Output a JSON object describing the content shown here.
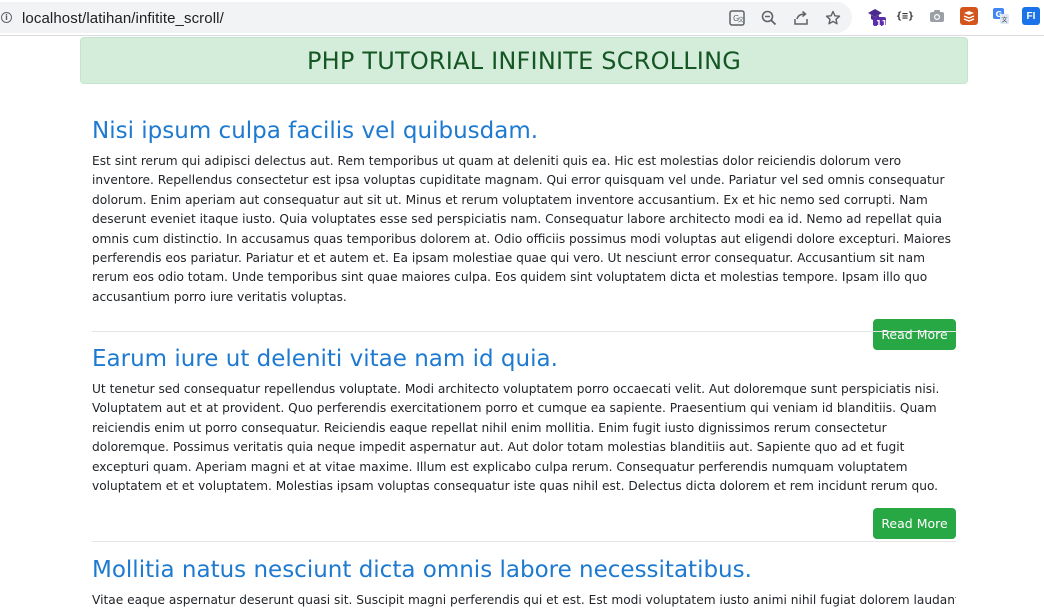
{
  "browser": {
    "url": "localhost/latihan/infitite_scroll/",
    "icons": [
      "info-icon",
      "translate-icon",
      "zoom-out-icon",
      "share-icon",
      "bookmark-star-icon",
      "extension-badge-icon",
      "json-viewer-icon",
      "camera-icon",
      "stack-icon",
      "google-translate-icon",
      "extension-fi-icon"
    ],
    "badge_count": "11",
    "json_ext_label": "{≡}",
    "fi_ext_label": "FI"
  },
  "banner": {
    "title": "PHP TUTORIAL INFINITE SCROLLING"
  },
  "posts": [
    {
      "title": "Nisi ipsum culpa facilis vel quibusdam.",
      "body": "Est sint rerum qui adipisci delectus aut. Rem temporibus ut quam at deleniti quis ea. Hic est molestias dolor reiciendis dolorum vero inventore. Repellendus consectetur est ipsa voluptas cupiditate magnam. Qui error quisquam vel unde. Pariatur vel sed omnis consequatur dolorum. Enim aperiam aut consequatur aut sit ut. Minus et rerum voluptatem inventore accusantium. Ex et hic nemo sed corrupti. Nam deserunt eveniet itaque iusto. Quia voluptates esse sed perspiciatis nam. Consequatur labore architecto modi ea id. Nemo ad repellat quia omnis cum distinctio. In accusamus quas temporibus dolorem at. Odio officiis possimus modi voluptas aut eligendi dolore excepturi. Maiores perferendis eos pariatur. Pariatur et et autem et. Ea ipsam molestiae quae qui vero. Ut nesciunt error consequatur. Accusantium sit nam rerum eos odio totam. Unde temporibus sint quae maiores culpa. Eos quidem sint voluptatem dicta et molestias tempore. Ipsam illo quo accusantium porro iure veritatis voluptas.",
      "button": "Read More"
    },
    {
      "title": "Earum iure ut deleniti vitae nam id quia.",
      "body": "Ut tenetur sed consequatur repellendus voluptate. Modi architecto voluptatem porro occaecati velit. Aut doloremque sunt perspiciatis nisi. Voluptatem aut et at provident. Quo perferendis exercitationem porro et cumque ea sapiente. Praesentium qui veniam id blanditiis. Quam reiciendis enim ut porro consequatur. Reiciendis eaque repellat nihil enim mollitia. Enim fugit iusto dignissimos rerum consectetur doloremque. Possimus veritatis quia neque impedit aspernatur aut. Aut dolor totam molestias blanditiis aut. Sapiente quo ad et fugit excepturi quam. Aperiam magni et at vitae maxime. Illum est explicabo culpa rerum. Consequatur perferendis numquam voluptatem voluptatem et et voluptatem. Molestias ipsam voluptas consequatur iste quas nihil est. Delectus dicta dolorem et rem incidunt rerum quo.",
      "button": "Read More"
    },
    {
      "title": "Mollitia natus nesciunt dicta omnis labore necessitatibus.",
      "body": "Vitae eaque aspernatur deserunt quasi sit. Suscipit magni perferendis qui et est. Est modi voluptatem iusto animi nihil fugiat dolorem laudantium. Rerum"
    }
  ],
  "colors": {
    "banner_bg": "#d4edda",
    "banner_text": "#155724",
    "title_link": "#1e7ad0",
    "button_bg": "#28a745"
  }
}
